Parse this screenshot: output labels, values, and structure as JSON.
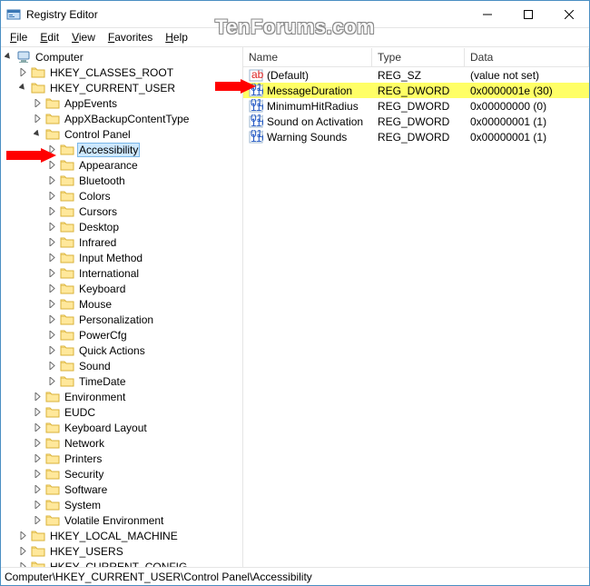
{
  "window": {
    "title": "Registry Editor"
  },
  "menu": {
    "file": "File",
    "edit": "Edit",
    "view": "View",
    "favorites": "Favorites",
    "help": "Help"
  },
  "watermark": "TenForums.com",
  "tree": {
    "root": "Computer",
    "hkeys": {
      "hkcr": "HKEY_CLASSES_ROOT",
      "hkcu": "HKEY_CURRENT_USER",
      "hklm": "HKEY_LOCAL_MACHINE",
      "hku": "HKEY_USERS",
      "hkcc": "HKEY_CURRENT_CONFIG"
    },
    "hkcu_children": [
      "AppEvents",
      "AppXBackupContentType",
      "Control Panel",
      "Environment",
      "EUDC",
      "Keyboard Layout",
      "Network",
      "Printers",
      "Security",
      "Software",
      "System",
      "Volatile Environment"
    ],
    "cp_children": [
      "Accessibility",
      "Appearance",
      "Bluetooth",
      "Colors",
      "Cursors",
      "Desktop",
      "Infrared",
      "Input Method",
      "International",
      "Keyboard",
      "Mouse",
      "Personalization",
      "PowerCfg",
      "Quick Actions",
      "Sound",
      "TimeDate"
    ],
    "selected": "Accessibility"
  },
  "list": {
    "headers": {
      "name": "Name",
      "type": "Type",
      "data": "Data"
    },
    "rows": [
      {
        "icon": "string",
        "name": "(Default)",
        "type": "REG_SZ",
        "data": "(value not set)",
        "highlight": false
      },
      {
        "icon": "dword",
        "name": "MessageDuration",
        "type": "REG_DWORD",
        "data": "0x0000001e (30)",
        "highlight": true
      },
      {
        "icon": "dword",
        "name": "MinimumHitRadius",
        "type": "REG_DWORD",
        "data": "0x00000000 (0)",
        "highlight": false
      },
      {
        "icon": "dword",
        "name": "Sound on Activation",
        "type": "REG_DWORD",
        "data": "0x00000001 (1)",
        "highlight": false
      },
      {
        "icon": "dword",
        "name": "Warning Sounds",
        "type": "REG_DWORD",
        "data": "0x00000001 (1)",
        "highlight": false
      }
    ]
  },
  "statusbar": "Computer\\HKEY_CURRENT_USER\\Control Panel\\Accessibility"
}
